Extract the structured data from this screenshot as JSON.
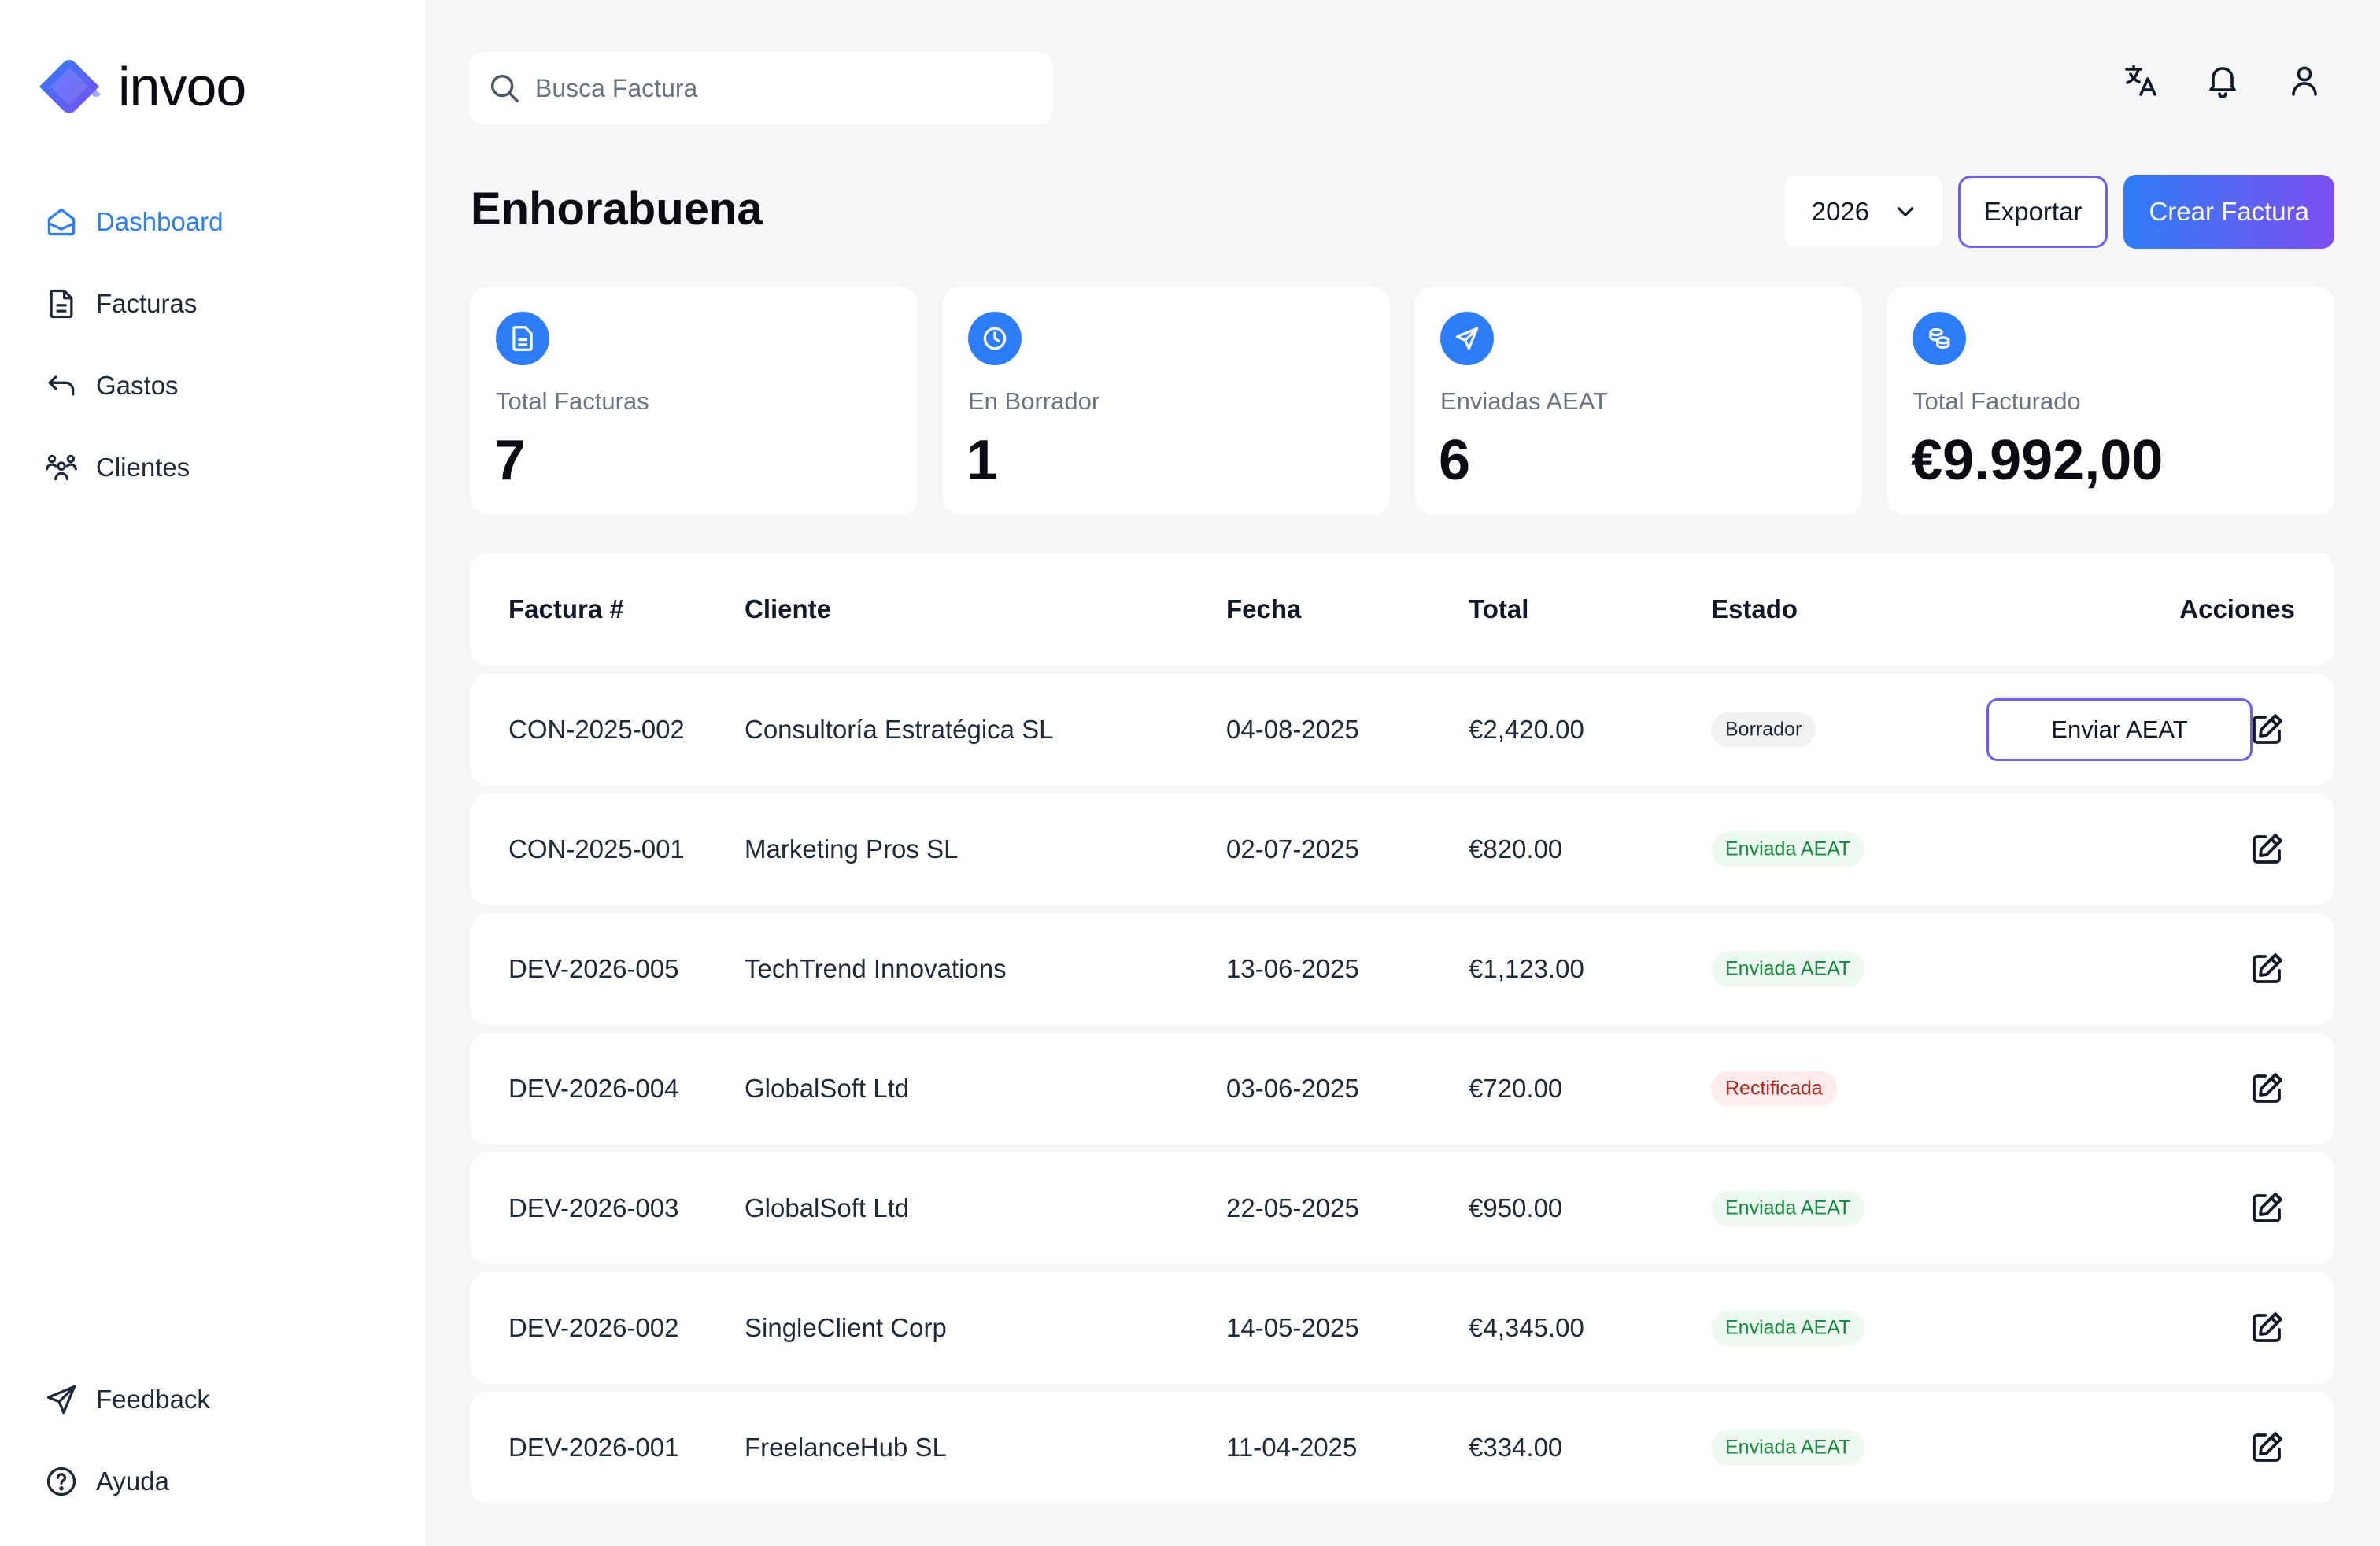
{
  "brand": {
    "name": "invoo",
    "colors": {
      "primary": "#2f7df6",
      "accent": "#7c4ff0"
    }
  },
  "sidebar": {
    "items": [
      {
        "label": "Dashboard",
        "icon": "home-icon",
        "active": true
      },
      {
        "label": "Facturas",
        "icon": "document-icon"
      },
      {
        "label": "Gastos",
        "icon": "return-arrow-icon"
      },
      {
        "label": "Clientes",
        "icon": "users-icon"
      }
    ],
    "bottom": [
      {
        "label": "Feedback",
        "icon": "send-icon"
      },
      {
        "label": "Ayuda",
        "icon": "help-icon"
      }
    ]
  },
  "search": {
    "placeholder": "Busca Factura",
    "value": ""
  },
  "topbar": {
    "icons": [
      "translate-icon",
      "bell-icon",
      "user-icon"
    ]
  },
  "header": {
    "title": "Enhorabuena",
    "year": "2026",
    "export_label": "Exportar",
    "create_label": "Crear Factura"
  },
  "stats": [
    {
      "label": "Total Facturas",
      "value": "7",
      "icon": "document-icon"
    },
    {
      "label": "En Borrador",
      "value": "1",
      "icon": "clock-icon"
    },
    {
      "label": "Enviadas AEAT",
      "value": "6",
      "icon": "send-icon"
    },
    {
      "label": "Total Facturado",
      "value": "€9.992,00",
      "icon": "coins-icon"
    }
  ],
  "table": {
    "columns": [
      "Factura #",
      "Cliente",
      "Fecha",
      "Total",
      "Estado",
      "Acciones"
    ],
    "send_label": "Enviar AEAT",
    "rows": [
      {
        "id": "CON-2025-002",
        "client": "Consultoría Estratégica SL",
        "date": "04-08-2025",
        "total": "€2,420.00",
        "status": "Borrador",
        "status_type": "borrador"
      },
      {
        "id": "CON-2025-001",
        "client": "Marketing Pros SL",
        "date": "02-07-2025",
        "total": "€820.00",
        "status": "Enviada AEAT",
        "status_type": "enviada"
      },
      {
        "id": "DEV-2026-005",
        "client": "TechTrend Innovations",
        "date": "13-06-2025",
        "total": "€1,123.00",
        "status": "Enviada AEAT",
        "status_type": "enviada"
      },
      {
        "id": "DEV-2026-004",
        "client": "GlobalSoft Ltd",
        "date": "03-06-2025",
        "total": "€720.00",
        "status": "Rectificada",
        "status_type": "rectificada"
      },
      {
        "id": "DEV-2026-003",
        "client": "GlobalSoft Ltd",
        "date": "22-05-2025",
        "total": "€950.00",
        "status": "Enviada AEAT",
        "status_type": "enviada"
      },
      {
        "id": "DEV-2026-002",
        "client": "SingleClient Corp",
        "date": "14-05-2025",
        "total": "€4,345.00",
        "status": "Enviada AEAT",
        "status_type": "enviada"
      },
      {
        "id": "DEV-2026-001",
        "client": "FreelanceHub SL",
        "date": "11-04-2025",
        "total": "€334.00",
        "status": "Enviada AEAT",
        "status_type": "enviada"
      }
    ]
  }
}
